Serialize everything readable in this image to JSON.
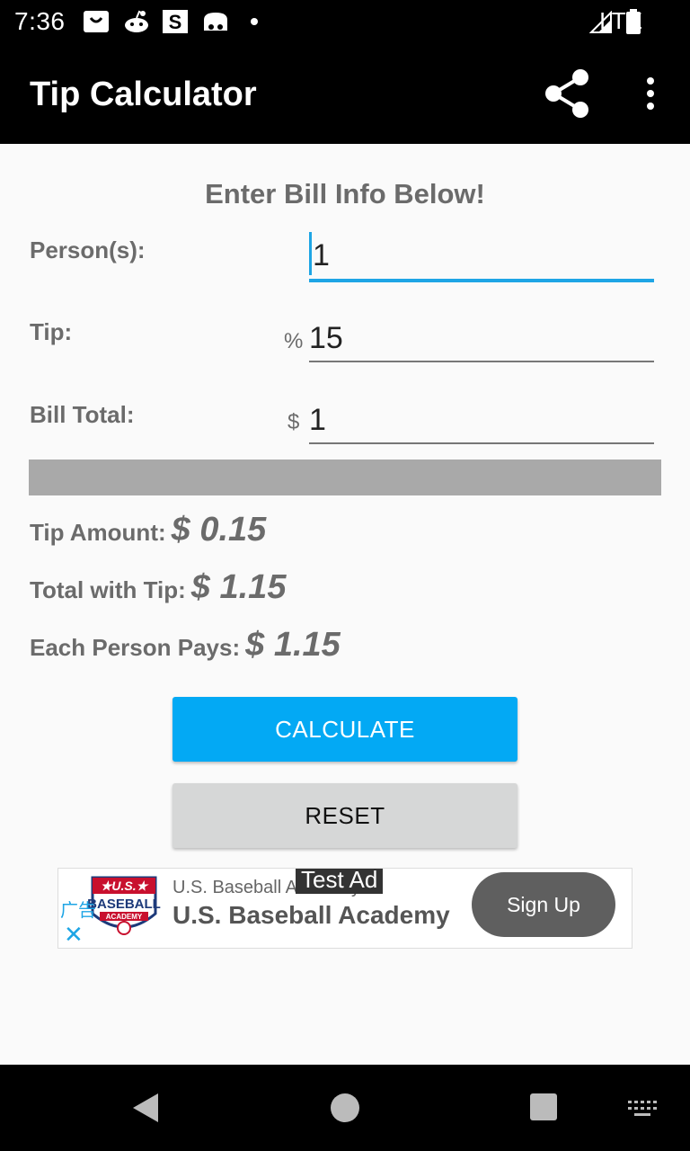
{
  "status_bar": {
    "time": "7:36",
    "network": "LTE",
    "notification_icons": [
      "bag-icon",
      "reddit-icon",
      "s-icon",
      "cat-icon",
      "dot-icon"
    ]
  },
  "app_bar": {
    "title": "Tip Calculator",
    "share_icon": "share-icon",
    "more_icon": "more-vert-icon"
  },
  "form": {
    "heading": "Enter Bill Info Below!",
    "persons_label": "Person(s):",
    "persons_value": "1",
    "tip_label": "Tip:",
    "tip_prefix": "%",
    "tip_value": "15",
    "bill_label": "Bill Total:",
    "bill_prefix": "$",
    "bill_value": "1"
  },
  "results": {
    "tip_amount_label": "Tip Amount:",
    "tip_amount_value": "$ 0.15",
    "total_label": "Total with Tip:",
    "total_value": "$ 1.15",
    "each_label": "Each Person Pays:",
    "each_value": "$ 1.15"
  },
  "buttons": {
    "calculate": "CALCULATE",
    "reset": "RESET"
  },
  "ad": {
    "badge": "Test Ad",
    "ad_mark": "广告",
    "subtitle": "U.S. Baseball Academy",
    "title": "U.S. Baseball Academy",
    "cta": "Sign Up",
    "logo_text": "U.S. BASEBALL ACADEMY"
  },
  "colors": {
    "accent": "#03a9f4",
    "input_focus": "#1ea5e5",
    "app_bar": "#000000",
    "text_gray": "#6b6b6b"
  }
}
